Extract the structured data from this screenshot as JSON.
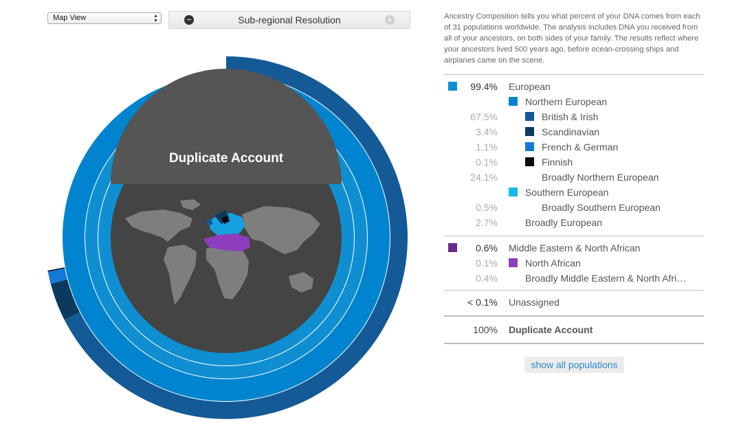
{
  "controls": {
    "view_select": "Map View",
    "resolution_label": "Sub-regional Resolution",
    "minus_glyph": "−",
    "plus_glyph": "+"
  },
  "intro_text": "Ancestry Composition tells you what percent of your DNA comes from each of 31 populations worldwide. The analysis includes DNA you received from all of your ancestors, on both sides of your family. The results reflect where your ancestors lived 500 years ago, before ocean-crossing ships and airplanes came on the scene.",
  "legend": [
    {
      "pct": "99.4%",
      "name": "European",
      "color": "#0f8fd1",
      "level": 0
    },
    {
      "pct": "",
      "name": "Northern European",
      "color": "#0084cf",
      "level": 1
    },
    {
      "pct": "67.5%",
      "name": "British & Irish",
      "color": "#145a96",
      "level": 2
    },
    {
      "pct": "3.4%",
      "name": "Scandinavian",
      "color": "#0b3a5e",
      "level": 2
    },
    {
      "pct": "1.1%",
      "name": "French & German",
      "color": "#1479d6",
      "level": 2
    },
    {
      "pct": "0.1%",
      "name": "Finnish",
      "color": "#0a0a14",
      "level": 2
    },
    {
      "pct": "24.1%",
      "name": "Broadly Northern European",
      "color": "",
      "level": 2
    },
    {
      "pct": "",
      "name": "Southern European",
      "color": "#16b9ee",
      "level": 1
    },
    {
      "pct": "0.5%",
      "name": "Broadly Southern European",
      "color": "",
      "level": 2
    },
    {
      "pct": "2.7%",
      "name": "Broadly European",
      "color": "",
      "level": 1
    },
    {
      "pct": "0.6%",
      "name": "Middle Eastern & North African",
      "color": "#6a2a8c",
      "level": 0
    },
    {
      "pct": "0.1%",
      "name": "North African",
      "color": "#8e3dbd",
      "level": 1
    },
    {
      "pct": "0.4%",
      "name": "Broadly Middle Eastern & North Afri…",
      "color": "",
      "level": 1
    },
    {
      "pct": "< 0.1%",
      "name": "Unassigned",
      "color": "",
      "level": 0
    }
  ],
  "total": {
    "pct": "100%",
    "name": "Duplicate Account"
  },
  "show_all_label": "show all populations",
  "center_title": "Duplicate Account",
  "chart_data": {
    "type": "pie",
    "subtype": "concentric donut (sunburst)",
    "title": "Duplicate Account",
    "rings": [
      {
        "level": "region",
        "segments": [
          {
            "name": "European",
            "value": 99.4,
            "color": "#0f8fd1"
          },
          {
            "name": "Middle Eastern & North African",
            "value": 0.6,
            "color": "#6a2a8c"
          }
        ]
      },
      {
        "level": "sub-region",
        "segments": [
          {
            "name": "Northern European",
            "value": 96.2,
            "color": "#0084cf"
          },
          {
            "name": "Southern European",
            "value": 0.5,
            "color": "#16b9ee"
          },
          {
            "name": "North African",
            "value": 0.1,
            "color": "#8e3dbd"
          }
        ]
      },
      {
        "level": "population",
        "segments": [
          {
            "name": "British & Irish",
            "value": 67.5,
            "color": "#145a96"
          },
          {
            "name": "Scandinavian",
            "value": 3.4,
            "color": "#0b3a5e"
          },
          {
            "name": "French & German",
            "value": 1.1,
            "color": "#1479d6"
          },
          {
            "name": "Finnish",
            "value": 0.1,
            "color": "#0a0a14"
          }
        ]
      }
    ]
  }
}
